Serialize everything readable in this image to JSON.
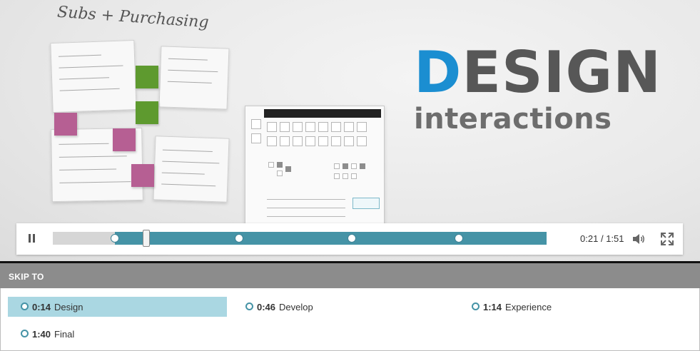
{
  "video": {
    "sketch_title": "Subs + Purchasing",
    "brand": {
      "first_letter": "D",
      "rest": "ESIGN",
      "subtitle": "interactions"
    },
    "colors": {
      "accent": "#1b8ed1",
      "progress": "#4593a6",
      "active_chapter": "#aad7e2"
    }
  },
  "player": {
    "pause_icon": "pause-icon",
    "current_time": "0:21",
    "separator": "/",
    "duration": "1:51",
    "volume_icon": "volume-icon",
    "fullscreen_icon": "fullscreen-icon",
    "played_fraction": 0.189,
    "chapter_fractions": [
      0.126,
      0.377,
      0.606,
      0.822
    ]
  },
  "skip": {
    "header": "SKIP TO",
    "chapters": [
      {
        "time": "0:14",
        "label": "Design",
        "active": true
      },
      {
        "time": "0:46",
        "label": "Develop",
        "active": false
      },
      {
        "time": "1:14",
        "label": "Experience",
        "active": false
      },
      {
        "time": "1:40",
        "label": "Final",
        "active": false
      }
    ]
  }
}
